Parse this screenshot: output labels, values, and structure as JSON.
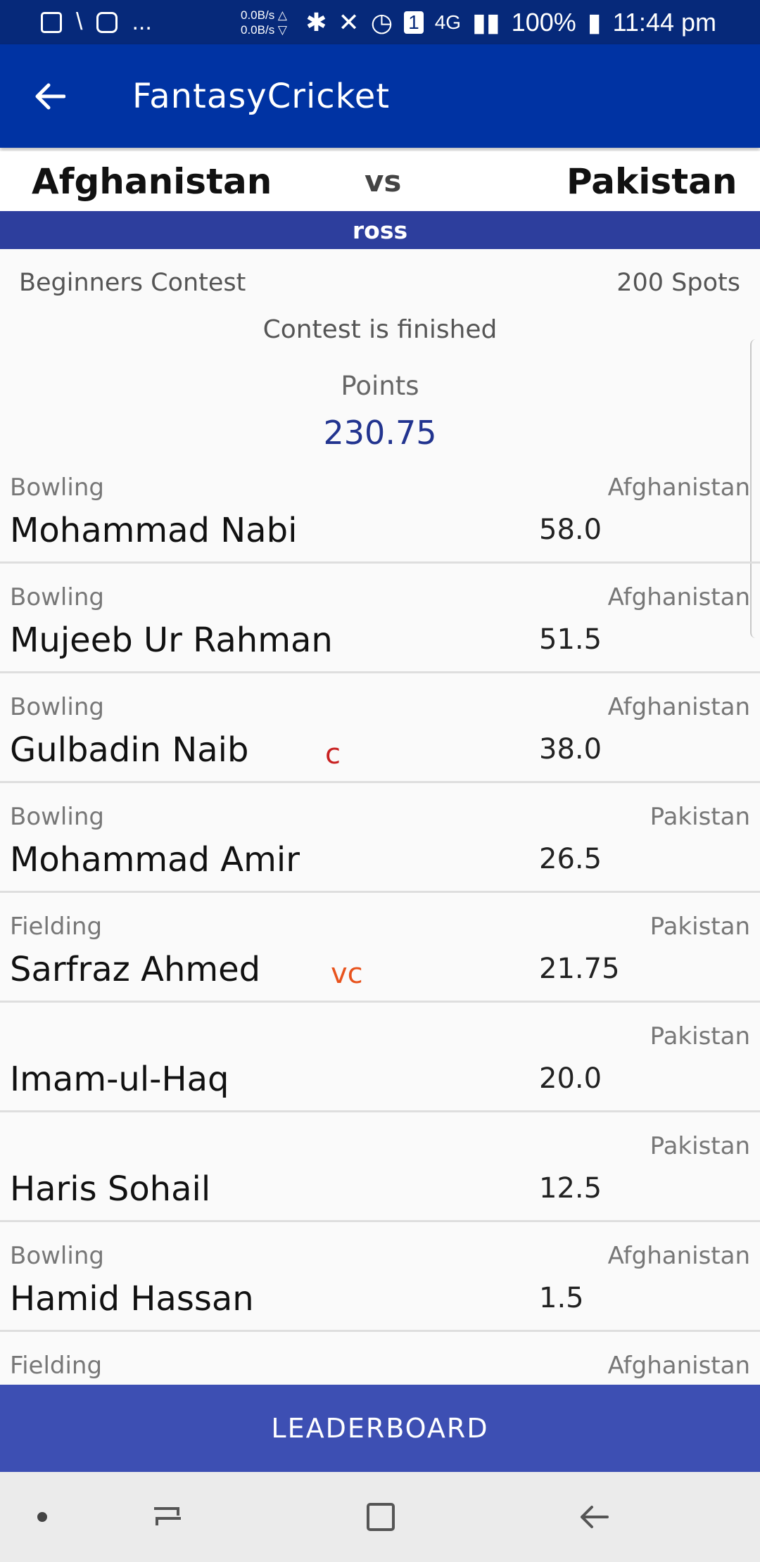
{
  "status_bar": {
    "net_up": "0.0B/s △",
    "net_down": "0.0B/s ▽",
    "notif_count": "1",
    "network": "4G",
    "battery": "100%",
    "time": "11:44 pm",
    "ellipsis": "..."
  },
  "app_bar": {
    "title": "FantasyCricket",
    "back_icon": "arrow-left-icon"
  },
  "match": {
    "team_a": "Afghanistan",
    "vs": "vs",
    "team_b": "Pakistan"
  },
  "user_bar": {
    "name": "ross"
  },
  "contest": {
    "name": "Beginners Contest",
    "spots": "200 Spots",
    "status": "Contest is finished",
    "points_label": "Points",
    "points_value": "230.75"
  },
  "players": [
    {
      "role": "Bowling",
      "name": "Mohammad Nabi",
      "badge": "",
      "score": "58.0",
      "team": "Afghanistan"
    },
    {
      "role": "Bowling",
      "name": "Mujeeb Ur Rahman",
      "badge": "",
      "score": "51.5",
      "team": "Afghanistan"
    },
    {
      "role": "Bowling",
      "name": "Gulbadin Naib",
      "badge": "c",
      "score": "38.0",
      "team": "Afghanistan"
    },
    {
      "role": "Bowling",
      "name": "Mohammad Amir",
      "badge": "",
      "score": "26.5",
      "team": "Pakistan"
    },
    {
      "role": "Fielding",
      "name": "Sarfraz Ahmed",
      "badge": "vc",
      "score": "21.75",
      "team": "Pakistan"
    },
    {
      "role": "",
      "name": "Imam-ul-Haq",
      "badge": "",
      "score": "20.0",
      "team": "Pakistan"
    },
    {
      "role": "",
      "name": "Haris Sohail",
      "badge": "",
      "score": "12.5",
      "team": "Pakistan"
    },
    {
      "role": "Bowling",
      "name": "Hamid Hassan",
      "badge": "",
      "score": "1.5",
      "team": "Afghanistan"
    },
    {
      "role": "Fielding",
      "name": "",
      "badge": "",
      "score": "",
      "team": "Afghanistan"
    }
  ],
  "bottom_button": {
    "label": "LEADERBOARD"
  },
  "nav": {
    "icons": [
      "dot-icon",
      "recents-icon",
      "home-square-icon",
      "back-arrow-icon"
    ]
  },
  "colors": {
    "status_bar": "#06297a",
    "app_bar": "#0033a3",
    "user_bar": "#2d3e9d",
    "leaderboard": "#3d4fb3",
    "points_value": "#22348f",
    "captain": "#c82020",
    "vice_captain": "#e8531d"
  }
}
